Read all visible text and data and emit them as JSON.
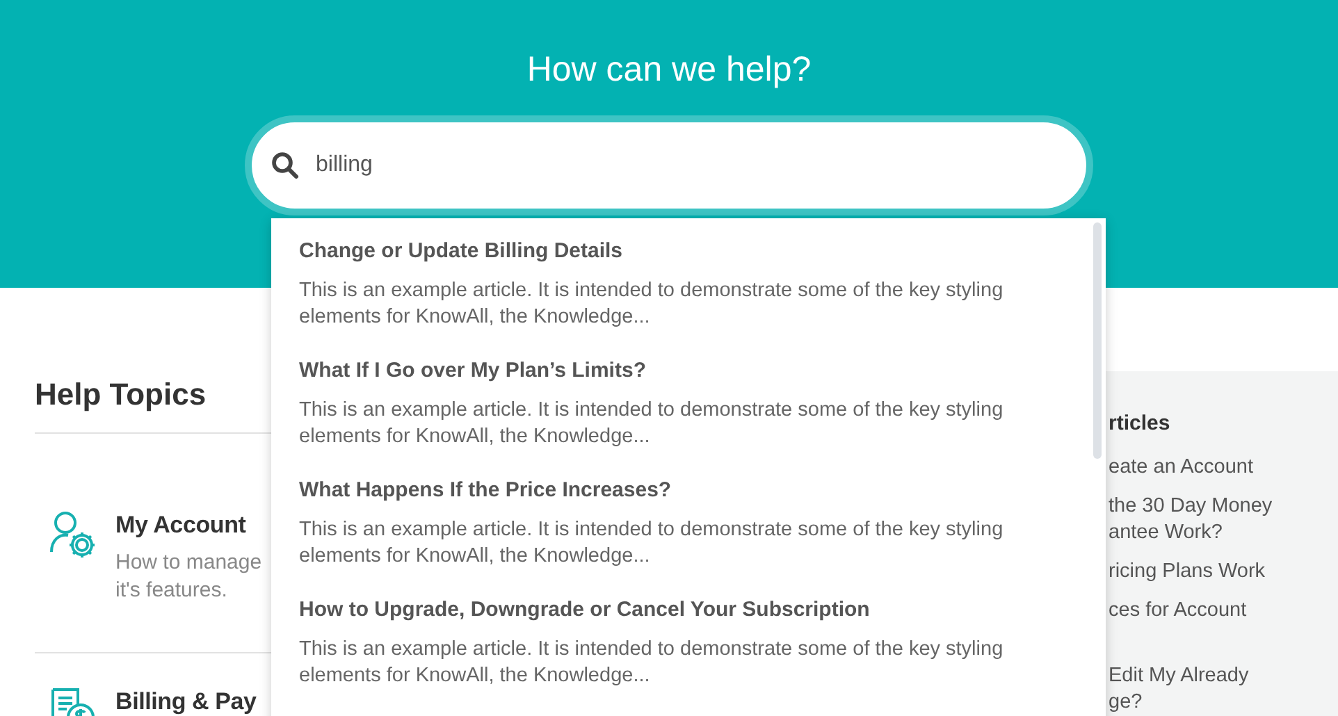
{
  "hero": {
    "title": "How can we help?"
  },
  "search": {
    "value": "billing"
  },
  "results": [
    {
      "title": "Change or Update Billing Details",
      "excerpt": "This is an example article. It is intended to demonstrate some of the key styling elements for KnowAll, the Knowledge..."
    },
    {
      "title": "What If I Go over My Plan’s Limits?",
      "excerpt": "This is an example article. It is intended to demonstrate some of the key styling elements for KnowAll, the Knowledge..."
    },
    {
      "title": "What Happens If the Price Increases?",
      "excerpt": "This is an example article. It is intended to demonstrate some of the key styling elements for KnowAll, the Knowledge..."
    },
    {
      "title": "How to Upgrade, Downgrade or Cancel Your Subscription",
      "excerpt": "This is an example article. It is intended to demonstrate some of the key styling elements for KnowAll, the Knowledge..."
    }
  ],
  "help_topics": {
    "heading": "Help Topics",
    "topics": [
      {
        "kind": "account",
        "title": "My Account",
        "description": [
          "How to manage",
          "it's features."
        ]
      },
      {
        "kind": "billing",
        "title": "Billing & Pay"
      }
    ]
  },
  "articles_panel": {
    "heading": "rticles",
    "links": [
      {
        "lines": [
          "eate an Account"
        ]
      },
      {
        "lines": [
          "the 30 Day Money",
          "antee Work?"
        ]
      },
      {
        "lines": [
          "ricing Plans Work"
        ]
      },
      {
        "lines": [
          "ces for Account"
        ]
      },
      {
        "lines": [
          "Edit My Already",
          "ge?"
        ]
      }
    ]
  }
}
